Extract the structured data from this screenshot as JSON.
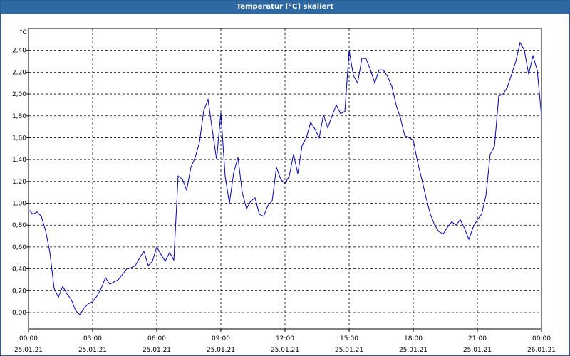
{
  "window": {
    "title": "Temperatur [°C] skaliert"
  },
  "colors": {
    "line": "#0000b4",
    "grid": "#000000",
    "title_bar": "#2e69a3"
  },
  "chart_data": {
    "type": "line",
    "ylabel": "°C",
    "ylim": [
      -0.15,
      2.6
    ],
    "y_ticks": [
      "0,00",
      "0,20",
      "0,40",
      "0,60",
      "0,80",
      "1,00",
      "1,20",
      "1,40",
      "1,60",
      "1,80",
      "2,00",
      "2,20",
      "2,40"
    ],
    "y_tick_values": [
      0,
      0.2,
      0.4,
      0.6,
      0.8,
      1.0,
      1.2,
      1.4,
      1.6,
      1.8,
      2.0,
      2.2,
      2.4
    ],
    "x_ticks": [
      {
        "time": "00:00",
        "date": "25.01.21"
      },
      {
        "time": "03:00",
        "date": "25.01.21"
      },
      {
        "time": "06:00",
        "date": "25.01.21"
      },
      {
        "time": "09:00",
        "date": "25.01.21"
      },
      {
        "time": "12:00",
        "date": "25.01.21"
      },
      {
        "time": "15:00",
        "date": "25.01.21"
      },
      {
        "time": "18:00",
        "date": "25.01.21"
      },
      {
        "time": "21:00",
        "date": "25.01.21"
      },
      {
        "time": "00:00",
        "date": "26.01.21"
      }
    ],
    "grid": true,
    "series": [
      {
        "x": [
          0.0,
          0.2,
          0.4,
          0.6,
          0.8,
          1.0,
          1.2,
          1.4,
          1.6,
          1.8,
          2.0,
          2.2,
          2.4,
          2.6,
          2.8,
          3.0,
          3.2,
          3.4,
          3.6,
          3.8,
          4.0,
          4.2,
          4.4,
          4.6,
          4.8,
          5.0,
          5.2,
          5.4,
          5.6,
          5.8,
          6.0,
          6.2,
          6.4,
          6.6,
          6.8,
          7.0,
          7.2,
          7.4,
          7.6,
          7.8,
          8.0,
          8.2,
          8.4,
          8.6,
          8.8,
          9.0,
          9.2,
          9.4,
          9.6,
          9.8,
          10.0,
          10.2,
          10.4,
          10.6,
          10.8,
          11.0,
          11.2,
          11.4,
          11.6,
          11.8,
          12.0,
          12.2,
          12.4,
          12.6,
          12.8,
          13.0,
          13.2,
          13.4,
          13.6,
          13.8,
          14.0,
          14.2,
          14.4,
          14.6,
          14.8,
          15.0,
          15.2,
          15.4,
          15.6,
          15.8,
          16.0,
          16.2,
          16.4,
          16.6,
          16.8,
          17.0,
          17.2,
          17.4,
          17.6,
          17.8,
          18.0,
          18.2,
          18.4,
          18.6,
          18.8,
          19.0,
          19.2,
          19.4,
          19.6,
          19.8,
          20.0,
          20.2,
          20.4,
          20.6,
          20.8,
          21.0,
          21.2,
          21.4,
          21.6,
          21.8,
          22.0,
          22.2,
          22.4,
          22.6,
          22.8,
          23.0,
          23.2,
          23.4,
          23.6,
          23.8,
          24.0
        ],
        "values": [
          0.94,
          0.9,
          0.92,
          0.88,
          0.75,
          0.55,
          0.22,
          0.14,
          0.24,
          0.17,
          0.12,
          0.02,
          -0.02,
          0.04,
          0.08,
          0.1,
          0.15,
          0.22,
          0.32,
          0.26,
          0.28,
          0.3,
          0.35,
          0.4,
          0.41,
          0.43,
          0.5,
          0.56,
          0.43,
          0.47,
          0.6,
          0.53,
          0.47,
          0.55,
          0.48,
          1.25,
          1.22,
          1.12,
          1.33,
          1.42,
          1.56,
          1.85,
          1.95,
          1.67,
          1.4,
          1.83,
          1.25,
          1.0,
          1.28,
          1.42,
          1.1,
          0.95,
          1.02,
          1.05,
          0.9,
          0.88,
          0.98,
          1.02,
          1.33,
          1.22,
          1.18,
          1.25,
          1.45,
          1.27,
          1.53,
          1.6,
          1.74,
          1.68,
          1.6,
          1.81,
          1.69,
          1.8,
          1.9,
          1.82,
          1.84,
          2.4,
          2.17,
          2.1,
          2.33,
          2.32,
          2.22,
          2.1,
          2.22,
          2.22,
          2.16,
          2.07,
          1.9,
          1.78,
          1.62,
          1.6,
          1.58,
          1.38,
          1.22,
          1.05,
          0.9,
          0.8,
          0.74,
          0.72,
          0.78,
          0.83,
          0.8,
          0.85,
          0.77,
          0.67,
          0.78,
          0.85,
          0.9,
          1.07,
          1.45,
          1.52,
          1.98,
          2.0,
          2.06,
          2.18,
          2.3,
          2.47,
          2.4,
          2.18,
          2.35,
          2.22,
          1.8
        ]
      }
    ]
  }
}
